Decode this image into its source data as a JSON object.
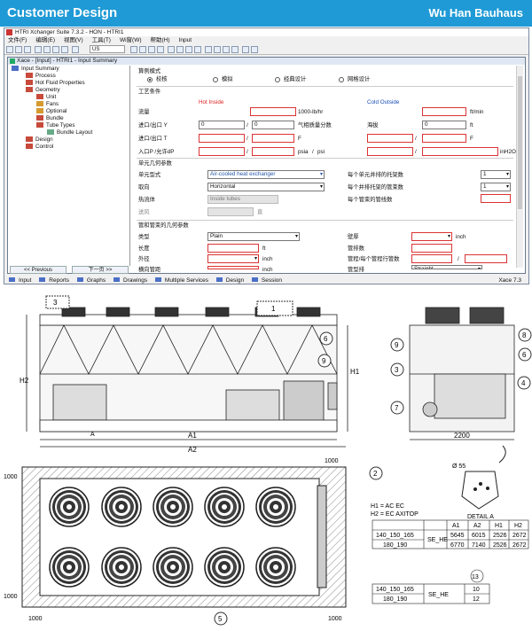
{
  "banner": {
    "left": "Customer Design",
    "right": "Wu Han Bauhaus"
  },
  "app": {
    "title": "HTRI Xchanger Suite 7.3.2 - HON - HTRI1",
    "menu": [
      "文件(F)",
      "编辑(E)",
      "视图(V)",
      "工具(T)",
      "Wi窗(W)",
      "帮助(H)",
      "Input"
    ],
    "units_select": "US",
    "child_title": "Xace - [Input] - HTRI1 - Input Summary",
    "version": "Xace 7.3"
  },
  "tree": [
    "Input Summary",
    "Process",
    "Hot Fluid Properties",
    "Geometry",
    "Unit",
    "Fans",
    "Optional",
    "Bundle",
    "Tube Types",
    "Bundle Layout",
    "Design",
    "Control"
  ],
  "tree_buttons": {
    "prev": "<< Previous",
    "next": "下一页 >>"
  },
  "form": {
    "calc_mode": "算例模式",
    "mode_options": [
      "校核",
      "模拟",
      "经典设计",
      "网格设计"
    ],
    "process_section": "工艺条件",
    "hot_inside": "Hot Inside",
    "cold_outside": "Cold Outside",
    "flow_label": "流量",
    "flow_unit": "1000-lb/hr",
    "cold_flow_unit": "ft/min",
    "inout_y": "进口/出口 Y",
    "val0a": "0",
    "val0b": "0",
    "quality": "气相质量分数",
    "altitude": "海拔",
    "ft": "ft",
    "inout_t": "进口/出口 T",
    "F": "F",
    "F2": "F",
    "pressure": "入口P /允许dP",
    "psia": "psia",
    "psi": "psi",
    "inh2o": "inH2O",
    "unit_section": "单元几何参数",
    "unit_type": "单元型式",
    "unit_type_val": "Air-cooled heat exchanger",
    "orient": "取向",
    "orient_val": "Horizontal",
    "fluid": "热流体",
    "fluid_val": "Inside tubes",
    "draft": "送风",
    "draft_unit": "直",
    "bays_label": "每个单元并排的托架数",
    "bays_val": "1",
    "bundles_label": "每个并排托架的管束数",
    "bundles_val": "1",
    "tubes_label": "每个管束的管线数",
    "tubes_val": "",
    "tube_section": "管和管束的几何参数",
    "tube_type": "类型",
    "tube_type_val": "Plain",
    "wall": "壁厚",
    "inch": "inch",
    "length": "长度",
    "ft3": "ft",
    "tube_rows": "管排数",
    "od": "外径",
    "inch2": "inch",
    "passes": "管程/每个管程行管数",
    "slash": "/",
    "pitch": "横向管距",
    "inch3": "inch",
    "pattern": "管型排",
    "pattern_val": "Straight"
  },
  "status_tabs": [
    "Input",
    "Reports",
    "Graphs",
    "Drawings",
    "Multiple Services",
    "Design",
    "Session"
  ],
  "drawing": {
    "callouts": [
      "3",
      "1",
      "6",
      "9",
      "2",
      "4",
      "5",
      "7",
      "8",
      "9",
      "6",
      "3"
    ],
    "dim_h2": "H2",
    "dim_h1": "H1",
    "dim_a1": "A1",
    "dim_a2": "A2",
    "dim_2200": "2200",
    "dim_1000s": [
      "1000",
      "1000",
      "1000",
      "1000",
      "1000"
    ],
    "detail_phi": "Ø 55",
    "detail_label": "DETAIL A",
    "a_label": "A",
    "legend1": "H1 = AC EC",
    "legend2": "H2 = EC AXITOP",
    "table1": {
      "headers": [
        "A1",
        "A2",
        "H1",
        "H2"
      ],
      "group": "SE_HE",
      "rows": [
        [
          "140_150_165",
          "5645",
          "6015",
          "2526",
          "2672"
        ],
        [
          "180_190",
          "6770",
          "7140",
          "2526",
          "2672"
        ]
      ]
    },
    "table2": {
      "header": "13",
      "group": "SE_HE",
      "rows": [
        [
          "140_150_165",
          "10"
        ],
        [
          "180_190",
          "12"
        ]
      ]
    }
  },
  "colors": {
    "banner": "#1f9ad6",
    "required": "#d22"
  }
}
